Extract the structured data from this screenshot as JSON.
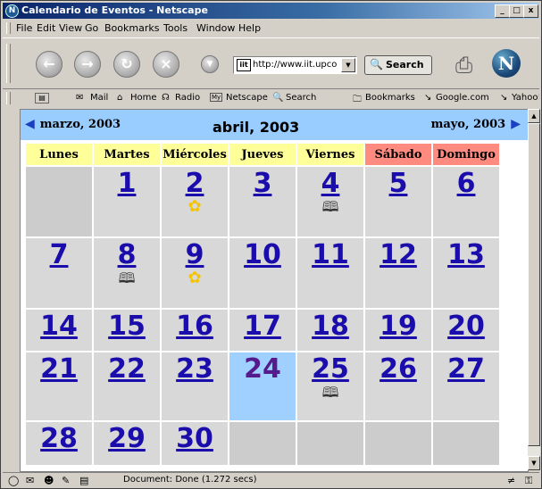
{
  "window": {
    "title": "Calendario de Eventos - Netscape",
    "app_icon": "netscape-icon",
    "controls": [
      "_",
      "□",
      "x"
    ]
  },
  "menu": [
    "File",
    "Edit",
    "View",
    "Go",
    "Bookmarks",
    "Tools",
    "Window",
    "Help"
  ],
  "navigation": {
    "url": "http://www.iit.upco",
    "search_label": "Search"
  },
  "personal_toolbar": [
    "Mail",
    "Home",
    "Radio",
    "Netscape",
    "Search",
    "Bookmarks",
    "Google.com",
    "Yahoo!"
  ],
  "calendar": {
    "prev_month": "marzo, 2003",
    "current_month": "abril, 2003",
    "next_month": "mayo, 2003",
    "weekdays": [
      "Lunes",
      "Martes",
      "Miércoles",
      "Jueves",
      "Viernes",
      "Sábado",
      "Domingo"
    ],
    "today": 24,
    "weeks": [
      [
        null,
        {
          "day": 1
        },
        {
          "day": 2,
          "event": "flower"
        },
        {
          "day": 3
        },
        {
          "day": 4,
          "event": "book"
        },
        {
          "day": 5
        },
        {
          "day": 6
        }
      ],
      [
        {
          "day": 7
        },
        {
          "day": 8,
          "event": "book"
        },
        {
          "day": 9,
          "event": "flower"
        },
        {
          "day": 10
        },
        {
          "day": 11
        },
        {
          "day": 12
        },
        {
          "day": 13
        }
      ],
      [
        {
          "day": 14
        },
        {
          "day": 15
        },
        {
          "day": 16
        },
        {
          "day": 17
        },
        {
          "day": 18
        },
        {
          "day": 19
        },
        {
          "day": 20
        }
      ],
      [
        {
          "day": 21
        },
        {
          "day": 22
        },
        {
          "day": 23
        },
        {
          "day": 24,
          "visited": true
        },
        {
          "day": 25,
          "event": "book"
        },
        {
          "day": 26
        },
        {
          "day": 27
        }
      ],
      [
        {
          "day": 28
        },
        {
          "day": 29
        },
        {
          "day": 30
        },
        null,
        null,
        null,
        null
      ]
    ]
  },
  "status": {
    "text": "Document: Done (1.272 secs)"
  },
  "colors": {
    "header_bg": "#99ccff",
    "weekday_bg": "#ffff99",
    "weekend_bg": "#ff8a80",
    "day_cell_bg": "#d8d8d8",
    "today_bg": "#9fd0ff",
    "link": "#1a0dab"
  }
}
